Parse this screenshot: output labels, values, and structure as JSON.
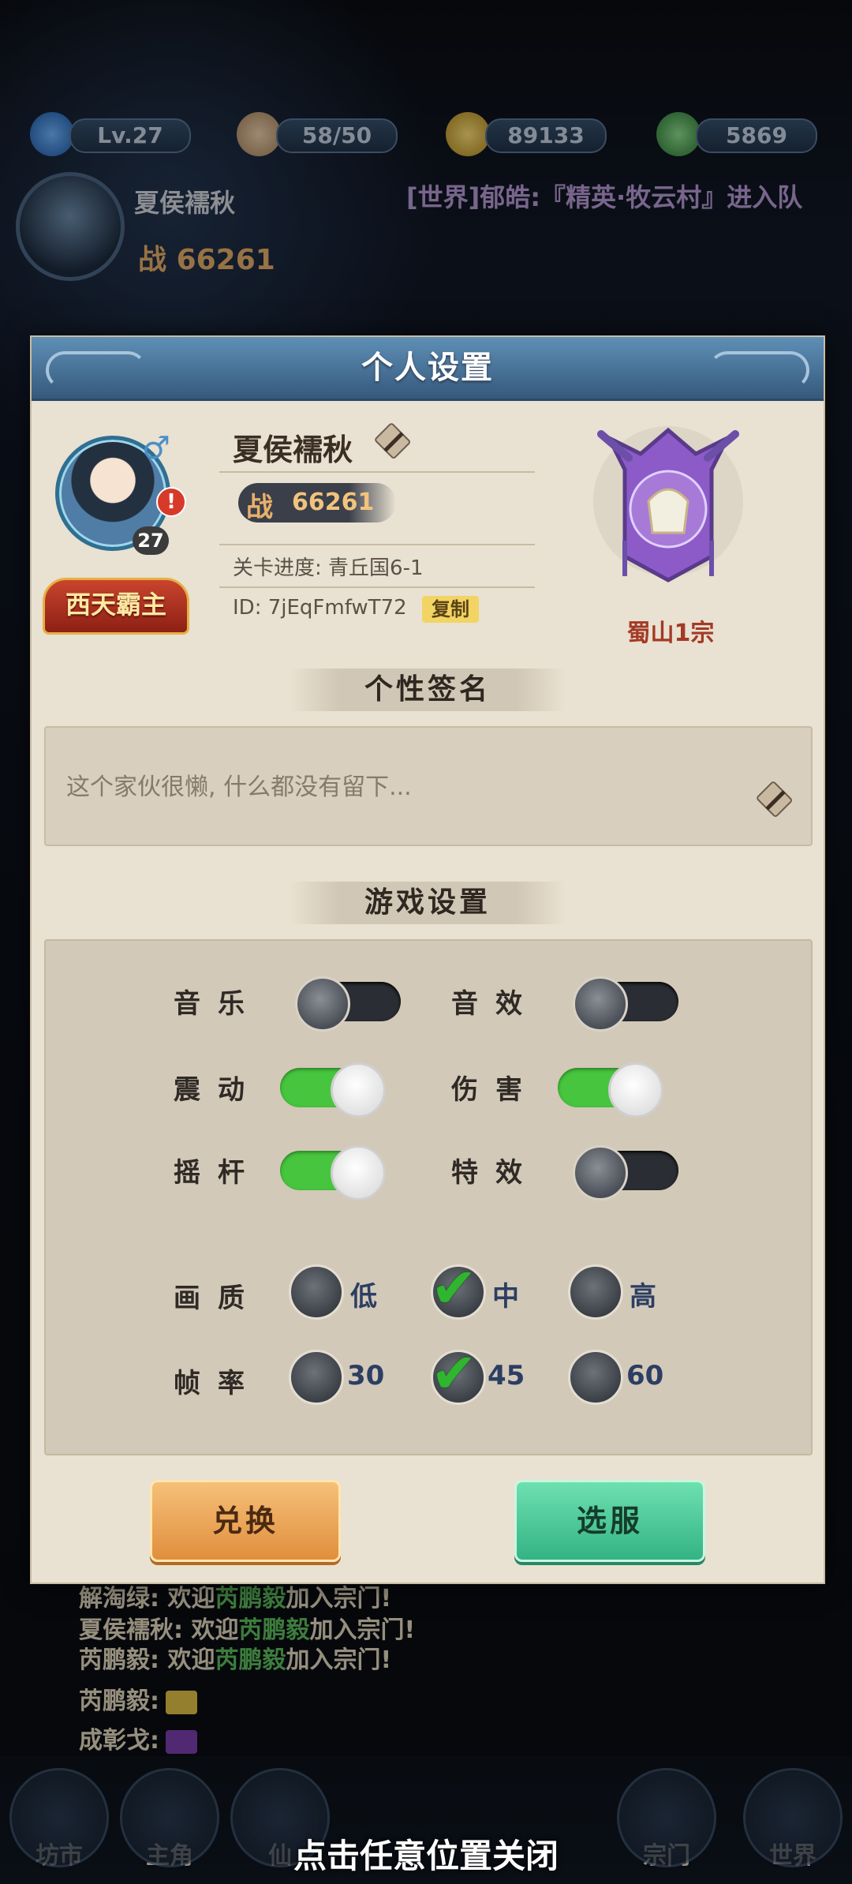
{
  "hud": {
    "level": "Lv.27",
    "stamina": "58/50",
    "coins": "89133",
    "jade": "5869",
    "player_name": "夏侯襦秋",
    "power_label": "战",
    "power_value": "66261",
    "world_channel": "[世界]郁皓:『精英·牧云村』进入队"
  },
  "chat": [
    {
      "name": "解淘绿:",
      "msg": " 欢迎",
      "who": "芮鹏毅",
      "tail": "加入宗门!"
    },
    {
      "name": "夏侯襦秋:",
      "msg": " 欢迎",
      "who": "芮鹏毅",
      "tail": "加入宗门!"
    },
    {
      "name": "芮鹏毅:",
      "msg": " 欢迎",
      "who": "芮鹏毅",
      "tail": "加入宗门!"
    },
    {
      "name": "芮鹏毅:",
      "msg": "",
      "who": "",
      "tail": ""
    },
    {
      "name": "成彰戈:",
      "msg": "",
      "who": "",
      "tail": ""
    }
  ],
  "nav": [
    "坊市",
    "主角",
    "仙",
    "宗门",
    "世界"
  ],
  "close_hint": "点击任意位置关闭",
  "dialog": {
    "title": "个人设置",
    "profile": {
      "name": "夏侯襦秋",
      "level": "27",
      "gender_symbol": "♂",
      "title_badge": "西天霸主",
      "power_label": "战",
      "power_value": "66261",
      "stage_progress": "关卡进度: 青丘国6-1",
      "id_text": "ID: 7jEqFmfwT72",
      "copy_label": "复制",
      "sect_name": "蜀山1宗"
    },
    "signature": {
      "heading": "个性签名",
      "text": "这个家伙很懒, 什么都没有留下..."
    },
    "settings": {
      "heading": "游戏设置",
      "toggles": [
        {
          "label": "音乐",
          "on": false
        },
        {
          "label": "音效",
          "on": false
        },
        {
          "label": "震动",
          "on": true
        },
        {
          "label": "伤害",
          "on": true
        },
        {
          "label": "摇杆",
          "on": true
        },
        {
          "label": "特效",
          "on": false
        }
      ],
      "quality": {
        "label": "画质",
        "options": [
          "低",
          "中",
          "高"
        ],
        "selected": "中"
      },
      "framerate": {
        "label": "帧率",
        "options": [
          "30",
          "45",
          "60"
        ],
        "selected": "45"
      }
    },
    "buttons": {
      "redeem": "兑换",
      "select_server": "选服"
    }
  },
  "colors": {
    "toggle_on": "#47c53f",
    "header_blue": "#4a7ba3",
    "panel_bg": "#e9e1d1",
    "sect_red": "#a33a26"
  }
}
